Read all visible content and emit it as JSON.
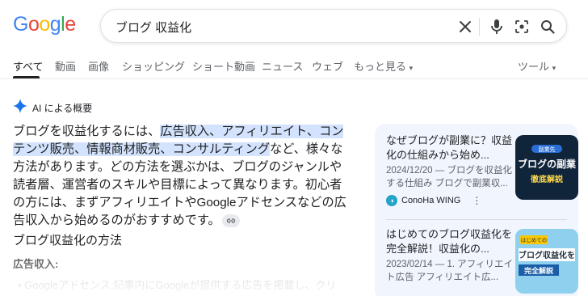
{
  "logo": {
    "letters": [
      "G",
      "o",
      "o",
      "g",
      "l",
      "e"
    ]
  },
  "search": {
    "query": "ブログ 収益化"
  },
  "tabs": [
    {
      "label": "すべて"
    },
    {
      "label": "動画"
    },
    {
      "label": "画像"
    },
    {
      "label": "ショッピング"
    },
    {
      "label": "ショート動画"
    },
    {
      "label": "ニュース"
    },
    {
      "label": "ウェブ"
    },
    {
      "label": "もっと見る"
    },
    {
      "label": "ツール"
    }
  ],
  "ai_overview": {
    "header": "AI による概要",
    "p1_a": "ブログを収益化するには、",
    "p1_hl1": "広告収入、アフィリエイト、コン",
    "p1_hl2": "テンツ販売、情報商材販売、コンサルティング",
    "p1_b": "など、様々な方法があります。どの方法を選ぶかは、ブログのジャンルや読者層、運営者のスキルや目標によって異なります。初心者の方には、まずアフィリエイトやGoogleアドセンスなどの広告収入から始めるのがおすすめです。",
    "section_title": "ブログ収益化の方法",
    "sub_title": "広告収入:",
    "faded_text": "• Googleアドセンス:記事内にGoogleが提供する広告を掲載し、クリ"
  },
  "sources": [
    {
      "title": "なぜブログが副業に？収益化の仕組みから始め...",
      "snippet": "2024/12/20 — ブログを収益化する仕組み ブログで副業収...",
      "site": "ConoHa WING",
      "thumb_tag": "副業先",
      "thumb_line1": "ブログの副業",
      "thumb_line2": "徹底解説"
    },
    {
      "title": "はじめてのブログ収益化を完全解説！収益化の...",
      "snippet": "2023/02/14 — 1. アフィリエイト広告 アフィリエイト広...",
      "thumb_tag": "はじめての",
      "thumb_line1": "ブログ収益化を",
      "thumb_line2": "完全解説"
    }
  ],
  "colors": {
    "accent": "#1a73e8",
    "highlight": "#d3e3fd",
    "panel": "#f1f5fd"
  }
}
